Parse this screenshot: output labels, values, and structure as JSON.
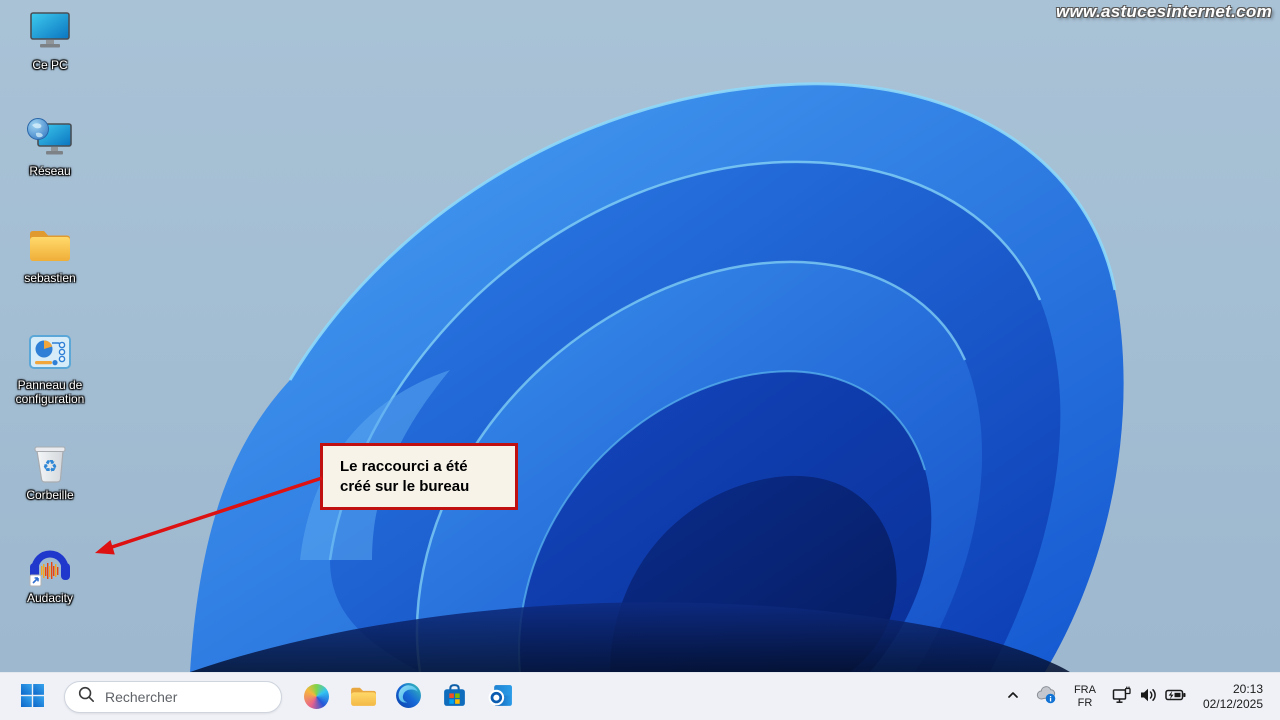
{
  "watermark": "www.astucesinternet.com",
  "desktop": {
    "icons": [
      {
        "label": "Ce PC",
        "icon": "computer-icon"
      },
      {
        "label": "Réseau",
        "icon": "network-places-icon"
      },
      {
        "label": "sebastien",
        "icon": "folder-icon"
      },
      {
        "label": "Panneau de configuration",
        "icon": "control-panel-icon"
      },
      {
        "label": "Corbeille",
        "icon": "recycle-bin-icon"
      },
      {
        "label": "Audacity",
        "icon": "audacity-shortcut-icon"
      }
    ]
  },
  "annotation": {
    "line1": "Le raccourci a été",
    "line2": "créé sur le bureau",
    "border_color": "#c01010",
    "background": "#f7f3e9",
    "arrow_color": "#dd1111"
  },
  "taskbar": {
    "search": {
      "placeholder": "Rechercher"
    },
    "apps": [
      {
        "name": "copilot"
      },
      {
        "name": "file-explorer"
      },
      {
        "name": "edge"
      },
      {
        "name": "microsoft-store"
      },
      {
        "name": "outlook"
      }
    ],
    "tray": {
      "language": {
        "line1": "FRA",
        "line2": "FR"
      },
      "clock": {
        "time": "20:13",
        "date": "02/12/2025"
      }
    }
  },
  "colors": {
    "taskbar_bg": "#eff1f7",
    "wallpaper_sky": "#a6bfd4",
    "bloom_blue": "#2e86ec",
    "start_blue": "#1174d2"
  }
}
